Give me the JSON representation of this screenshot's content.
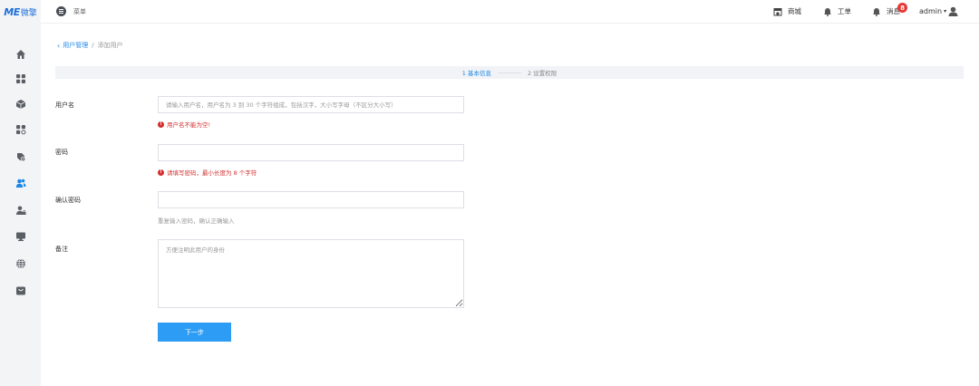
{
  "sidebar": {
    "logo_mark": "ME",
    "logo_text": "微擎",
    "items": [
      {
        "icon": "home-icon"
      },
      {
        "icon": "apps-grid-icon"
      },
      {
        "icon": "cube-icon"
      },
      {
        "icon": "modules-icon"
      },
      {
        "icon": "settings-gear-icon"
      },
      {
        "icon": "users-icon"
      },
      {
        "icon": "user-lock-icon"
      },
      {
        "icon": "monitor-icon"
      },
      {
        "icon": "globe-icon"
      },
      {
        "icon": "store-icon"
      }
    ]
  },
  "header": {
    "menu_label": "菜单",
    "shop_label": "商城",
    "ticket_label": "工单",
    "message_label": "消息",
    "message_badge": "8",
    "user_name": "admin"
  },
  "breadcrumb": {
    "parent": "用户管理",
    "separator": "/",
    "current": "添加用户"
  },
  "steps": {
    "step1": "1 基本信息",
    "step2": "2 设置权限"
  },
  "form": {
    "username_label": "用户名",
    "username_placeholder": "请输入用户名，用户名为 3 到 30 个字符组成，包括汉字，大小写字母（不区分大小写）",
    "username_error": "用户名不能为空!",
    "password_label": "密码",
    "password_error": "请填写密码，最小长度为 8 个字符",
    "confirm_label": "确认密码",
    "confirm_hint": "重复输入密码，确认正确输入",
    "remark_label": "备注",
    "remark_placeholder": "方便注明此用户的身份",
    "next_button": "下一步"
  },
  "colors": {
    "accent": "#1e88e5",
    "button": "#2d9cf4",
    "error": "#d32f2f",
    "sidebar_bg": "#f3f4f6"
  }
}
